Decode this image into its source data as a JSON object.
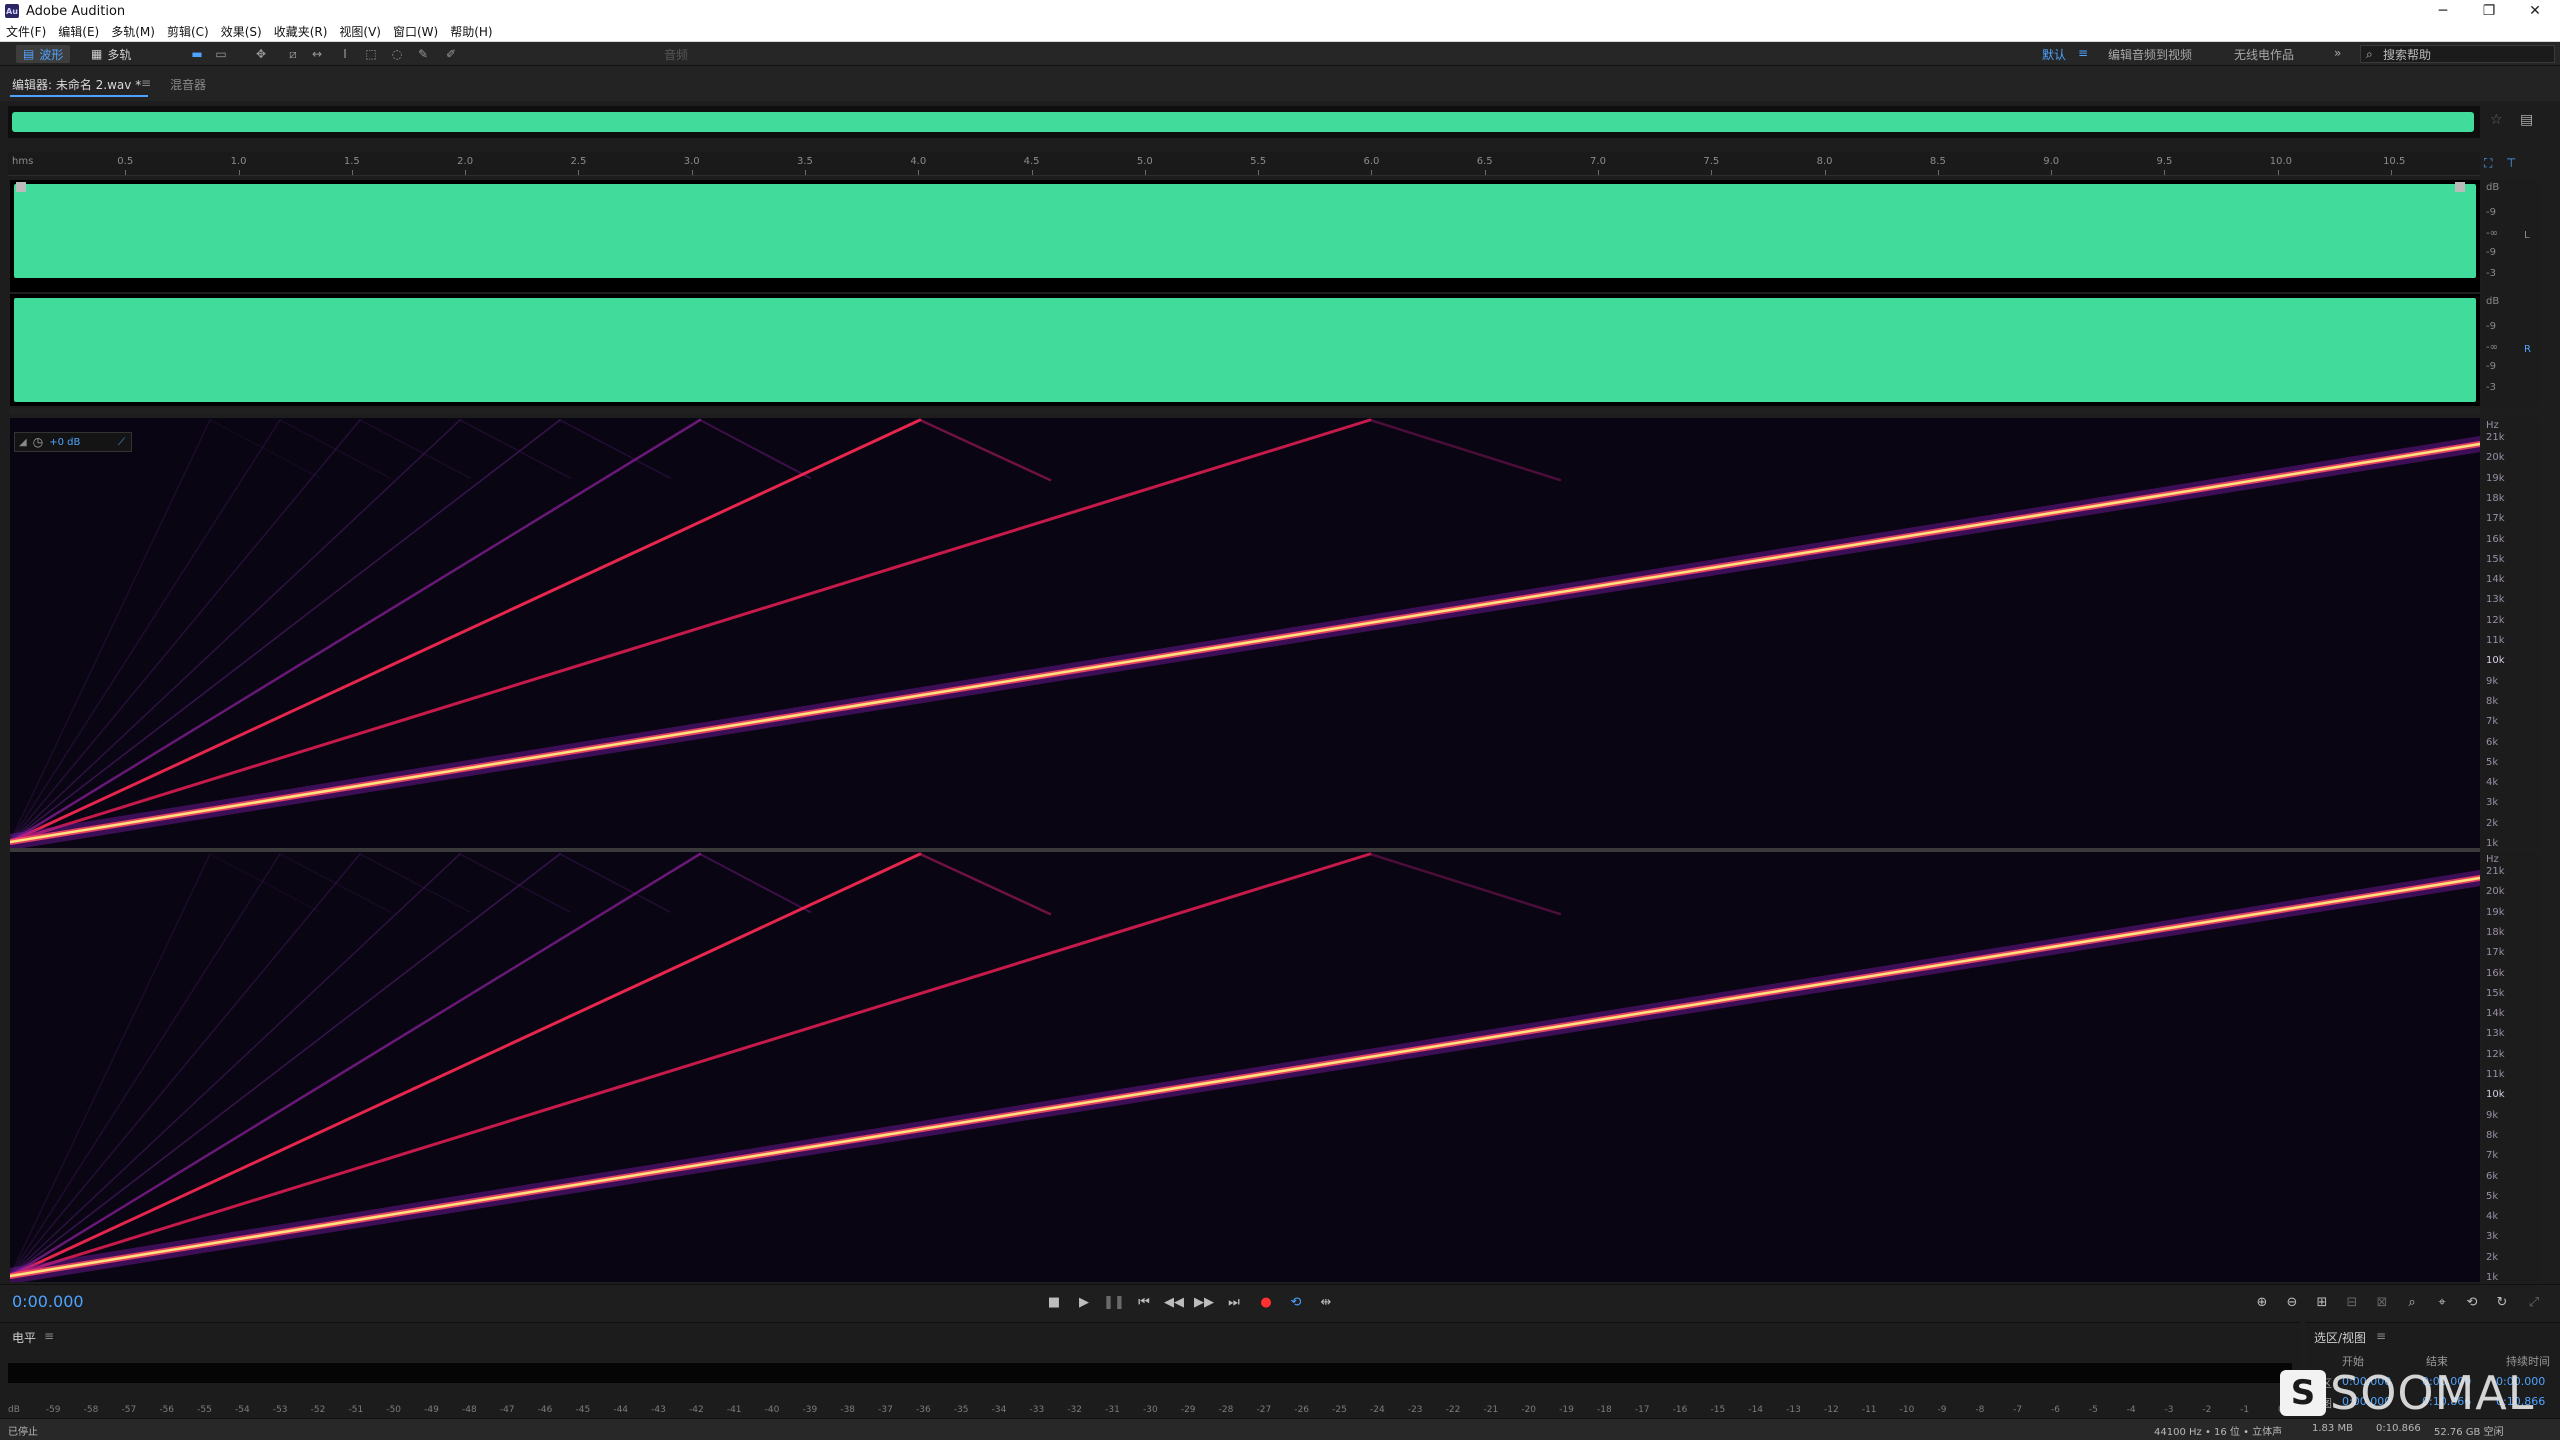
{
  "window": {
    "title": "Adobe Audition",
    "logo_text": "Au"
  },
  "menu": [
    "文件(F)",
    "编辑(E)",
    "多轨(M)",
    "剪辑(C)",
    "效果(S)",
    "收藏夹(R)",
    "视图(V)",
    "窗口(W)",
    "帮助(H)"
  ],
  "toolbar": {
    "mode_waveform": "波形",
    "mode_multitrack": "多轨",
    "disabled_label": "音频",
    "workspace_default": "默认",
    "workspace_video": "编辑音频到视频",
    "workspace_radio": "无线电作品",
    "search_placeholder": "搜索帮助"
  },
  "panel": {
    "editor_tab": "编辑器: 未命名 2.wav *",
    "mixer_tab": "混音器"
  },
  "ruler": {
    "unit_label": "hms",
    "ticks": [
      "0.5",
      "1.0",
      "1.5",
      "2.0",
      "2.5",
      "3.0",
      "3.5",
      "4.0",
      "4.5",
      "5.0",
      "5.5",
      "6.0",
      "6.5",
      "7.0",
      "7.5",
      "8.0",
      "8.5",
      "9.0",
      "9.5",
      "10.0",
      "10.5"
    ]
  },
  "waveform_scale": {
    "labels": [
      "dB",
      "-9",
      "-∞",
      "-9",
      "-3"
    ],
    "channel_left": "L",
    "channel_right": "R"
  },
  "spectral": {
    "hud_gain": "+0 dB",
    "hz_labels": [
      "Hz",
      "21k",
      "20k",
      "19k",
      "18k",
      "17k",
      "16k",
      "15k",
      "14k",
      "13k",
      "12k",
      "11k",
      "10k",
      "9k",
      "8k",
      "7k",
      "6k",
      "5k",
      "4k",
      "3k",
      "2k",
      "1k"
    ]
  },
  "transport": {
    "timecode": "0:00.000"
  },
  "levels": {
    "title": "电平",
    "scale": [
      "dB",
      "-59",
      "-58",
      "-57",
      "-56",
      "-55",
      "-54",
      "-53",
      "-52",
      "-51",
      "-50",
      "-49",
      "-48",
      "-47",
      "-46",
      "-45",
      "-44",
      "-43",
      "-42",
      "-41",
      "-40",
      "-39",
      "-38",
      "-37",
      "-36",
      "-35",
      "-34",
      "-33",
      "-32",
      "-31",
      "-30",
      "-29",
      "-28",
      "-27",
      "-26",
      "-25",
      "-24",
      "-23",
      "-22",
      "-21",
      "-20",
      "-19",
      "-18",
      "-17",
      "-16",
      "-15",
      "-14",
      "-13",
      "-12",
      "-11",
      "-10",
      "-9",
      "-8",
      "-7",
      "-6",
      "-5",
      "-4",
      "-3",
      "-2",
      "-1",
      "0"
    ]
  },
  "selection": {
    "title": "选区/视图",
    "col_start": "开始",
    "col_end": "结束",
    "col_duration": "持续时间",
    "row_selection": "选区",
    "row_view": "视图",
    "sel_start": "0:00.000",
    "sel_end": "0:00.000",
    "sel_duration": "0:00.000",
    "view_start": "0:00.000",
    "view_end": "0:10.866",
    "view_duration": "0:10.866"
  },
  "status": {
    "state": "已停止",
    "format": "44100 Hz • 16 位 • 立体声",
    "size": "1.83 MB",
    "duration": "0:10.866",
    "free": "52.76 GB 空闲"
  },
  "watermark": {
    "mark": "S",
    "text": "SOOMAL"
  },
  "colors": {
    "waveform": "#41dc9c",
    "accent": "#4ea3ff",
    "spectral_bg": "#0a0512"
  }
}
